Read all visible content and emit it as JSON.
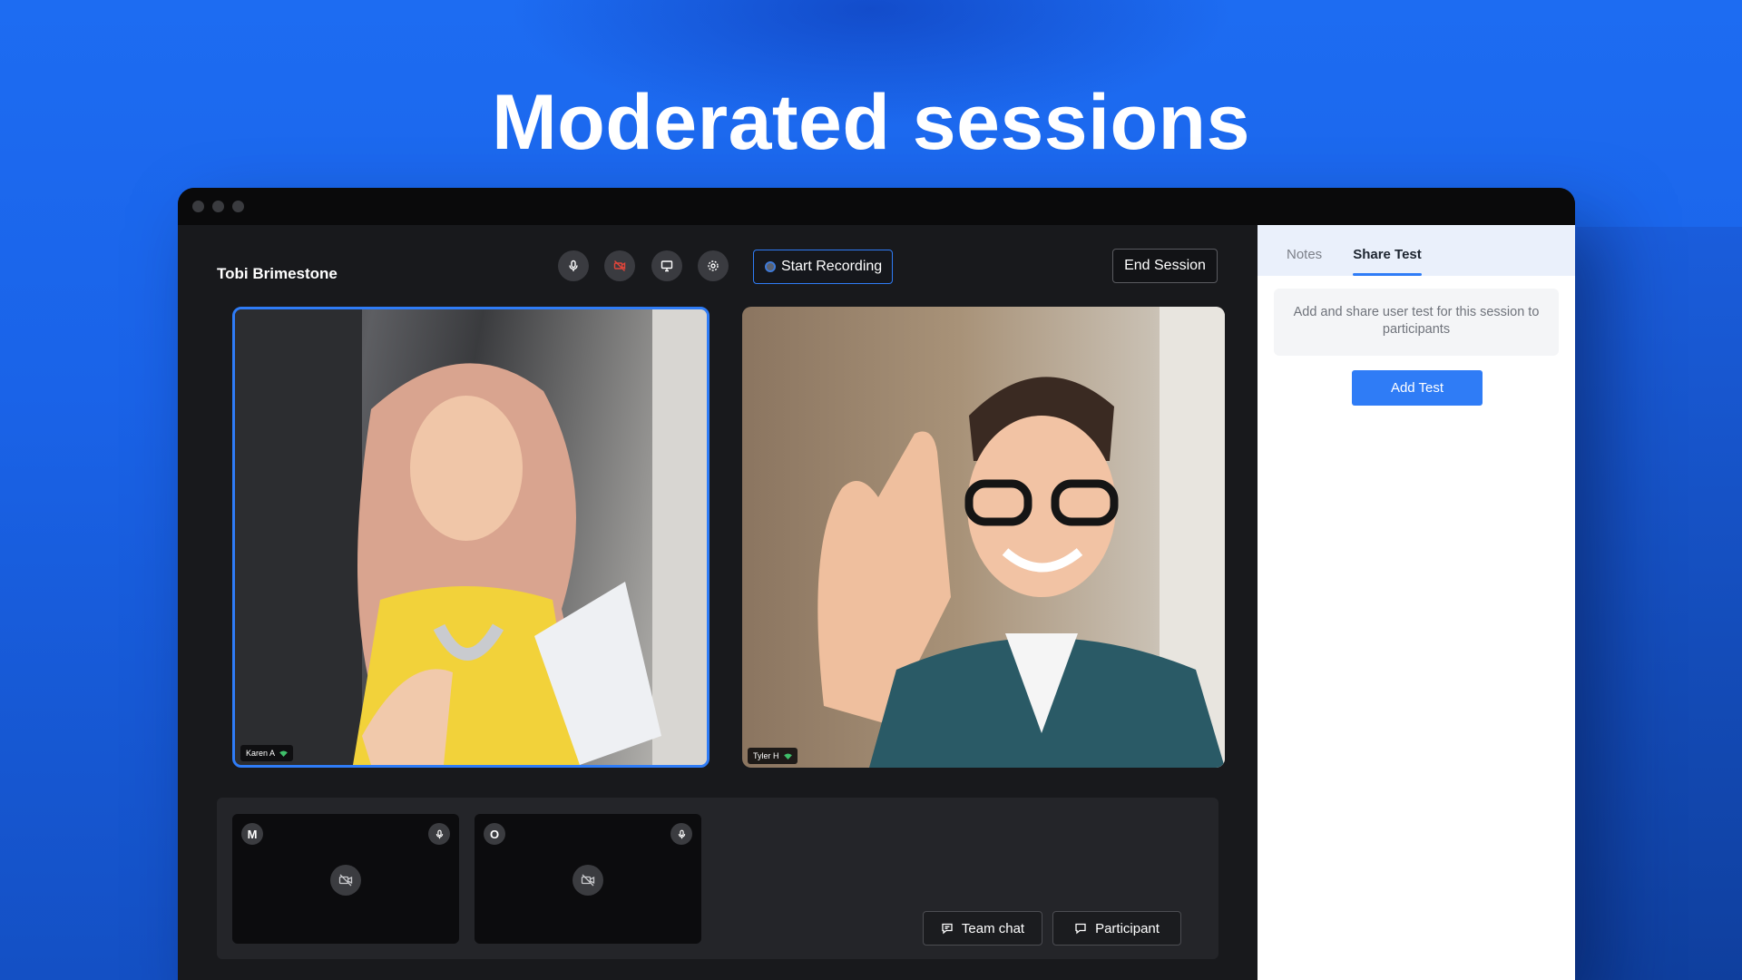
{
  "hero": {
    "title": "Moderated sessions"
  },
  "session": {
    "host_name": "Tobi Brimestone",
    "controls": {
      "mic_icon": "microphone-icon",
      "camera_icon": "camera-off-icon",
      "screen_icon": "screen-share-icon",
      "settings_icon": "gear-icon"
    },
    "start_recording_label": "Start Recording",
    "end_session_label": "End Session"
  },
  "participants": {
    "main": [
      {
        "name": "Karen A",
        "active_speaker": true
      },
      {
        "name": "Tyler H",
        "active_speaker": false
      }
    ],
    "thumbnails": [
      {
        "initial": "M"
      },
      {
        "initial": "O"
      }
    ]
  },
  "bottom_actions": {
    "team_chat_label": "Team chat",
    "participant_label": "Participant"
  },
  "side_panel": {
    "tabs": [
      {
        "label": "Notes",
        "active": false
      },
      {
        "label": "Share Test",
        "active": true
      }
    ],
    "info_text": "Add and share user test for this session to participants",
    "add_test_label": "Add Test"
  },
  "colors": {
    "accent": "#2f7cf6",
    "background_blue": "#1d6cf2",
    "camera_off_red": "#e0453a"
  }
}
